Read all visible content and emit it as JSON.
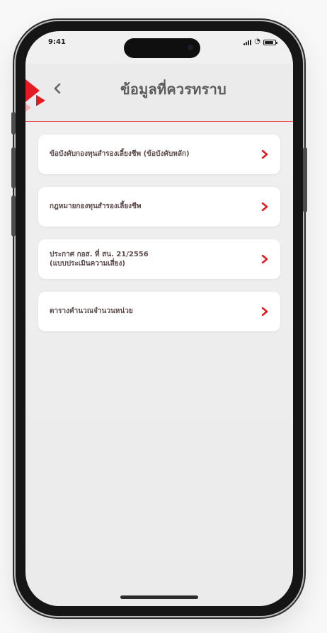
{
  "status_bar": {
    "time": "9:41"
  },
  "header": {
    "title": "ข้อมูลที่ควรทราบ",
    "back_icon": "chevron-left-icon"
  },
  "list": {
    "items": [
      {
        "label": "ข้อบังคับกองทุนสำรองเลี้ยงชีพ (ข้อบังคับหลัก)"
      },
      {
        "label": "กฎหมายกองทุนสำรองเลี้ยงชีพ"
      },
      {
        "label": "ประกาศ กอส. ที่ สน. 21/2556\n(แบบประเมินความเสี่ยง)"
      },
      {
        "label": "ตารางคำนวณจำนวนหน่วย"
      }
    ]
  },
  "colors": {
    "accent": "#e31b23",
    "brand": "#e31b23",
    "divider": "#ea4b4b"
  }
}
